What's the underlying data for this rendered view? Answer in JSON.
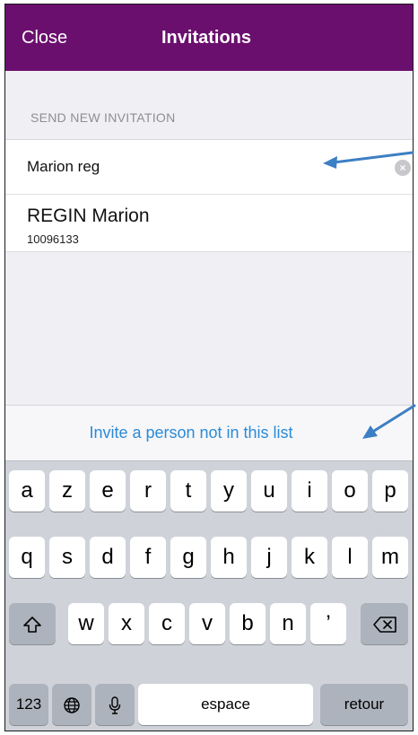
{
  "navbar": {
    "close_label": "Close",
    "title": "Invitations",
    "background": "#6b0f6e"
  },
  "section": {
    "label": "SEND NEW INVITATION"
  },
  "search": {
    "value": "Marion reg",
    "clear_icon": "clear-circle-icon"
  },
  "results": [
    {
      "name": "REGIN Marion",
      "id": "10096133"
    }
  ],
  "invite": {
    "link_label": "Invite a person not in this list",
    "color": "#2a8bd8"
  },
  "keyboard": {
    "row1": [
      "a",
      "z",
      "e",
      "r",
      "t",
      "y",
      "u",
      "i",
      "o",
      "p"
    ],
    "row2": [
      "q",
      "s",
      "d",
      "f",
      "g",
      "h",
      "j",
      "k",
      "l",
      "m"
    ],
    "row3": [
      "w",
      "x",
      "c",
      "v",
      "b",
      "n",
      "’"
    ],
    "numbers_label": "123",
    "space_label": "espace",
    "return_label": "retour",
    "shift_icon": "shift-icon",
    "backspace_icon": "backspace-icon",
    "globe_icon": "globe-icon",
    "mic_icon": "microphone-icon"
  },
  "annotations": {
    "arrow_color": "#3c7fc4"
  }
}
